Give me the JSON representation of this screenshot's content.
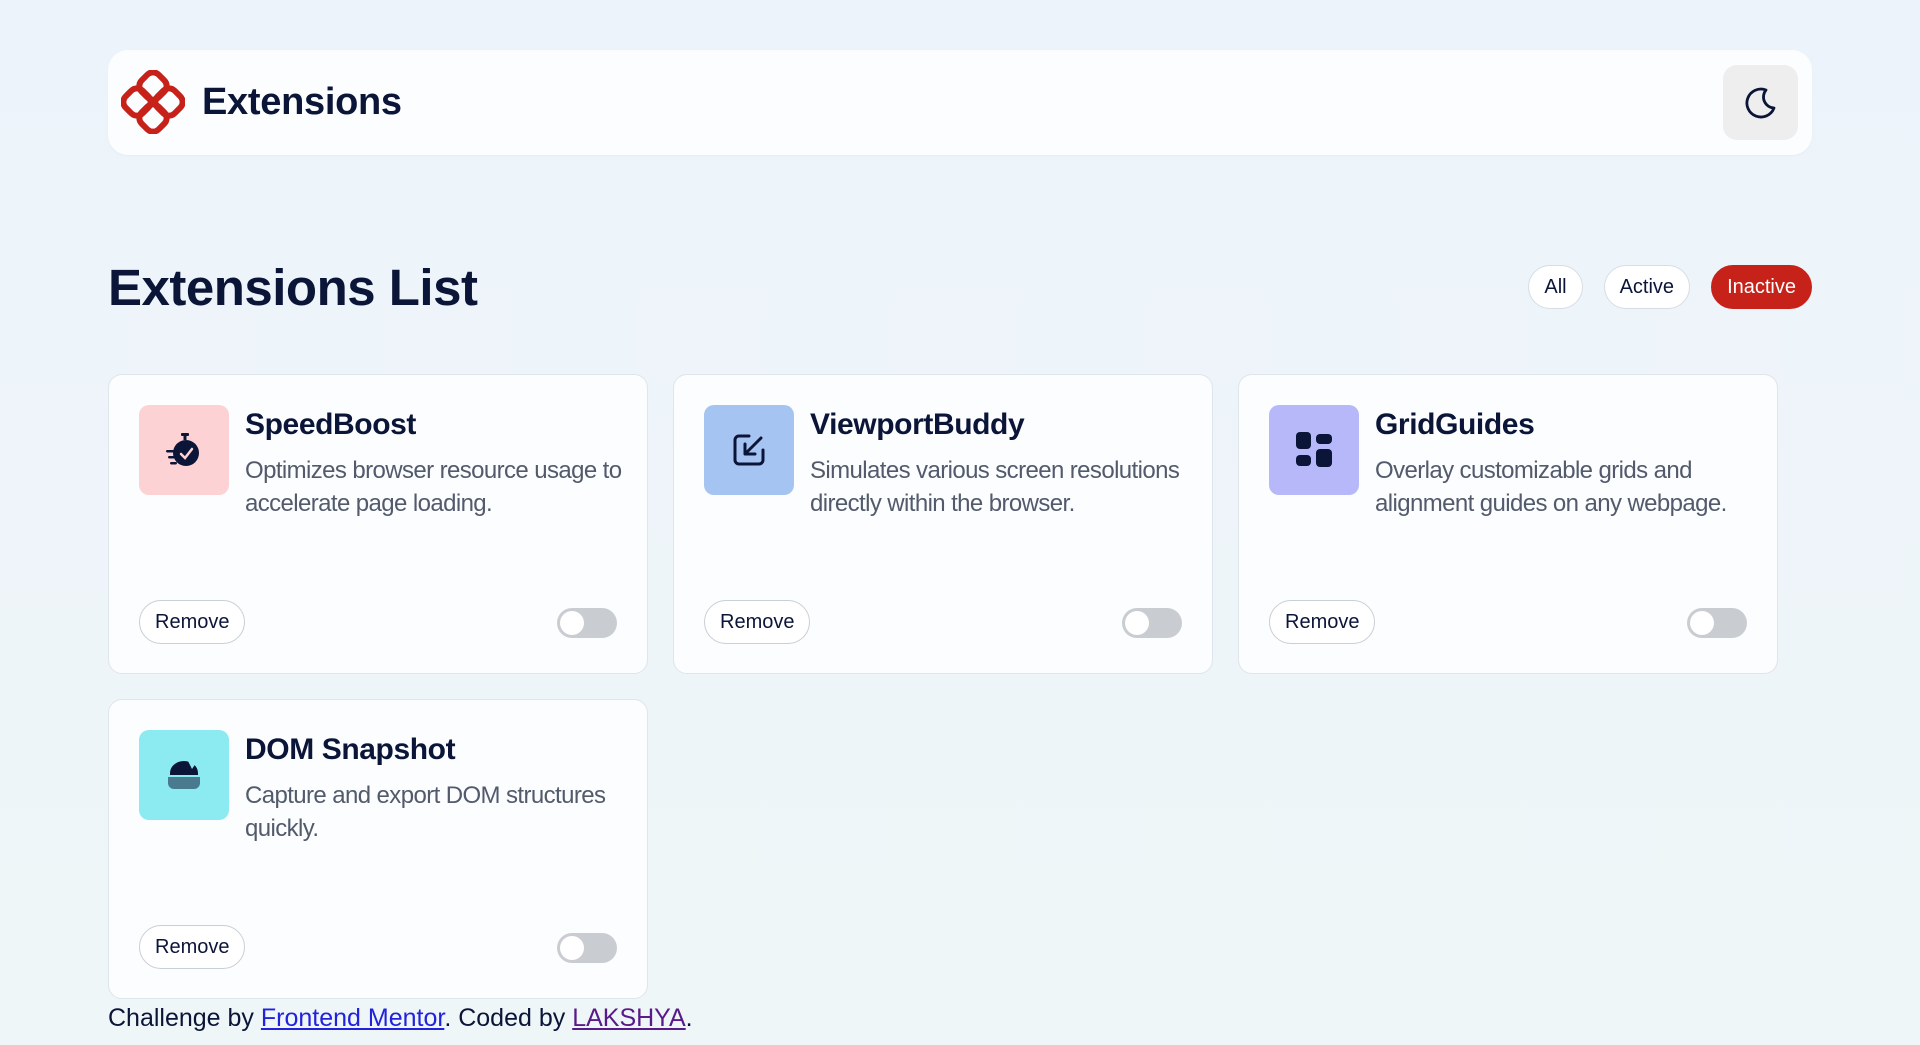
{
  "header": {
    "brand": "Extensions",
    "logo_icon": "extensions-logo-icon",
    "theme_icon": "moon-icon",
    "accent": "#c7221a"
  },
  "main": {
    "title": "Extensions List",
    "filters": [
      {
        "label": "All",
        "active": false
      },
      {
        "label": "Active",
        "active": false
      },
      {
        "label": "Inactive",
        "active": true
      }
    ]
  },
  "extensions": [
    {
      "name": "SpeedBoost",
      "description": "Optimizes browser resource usage to accelerate page loading.",
      "remove_label": "Remove",
      "enabled": false,
      "icon": "stopwatch-icon",
      "icon_bg": "#fdd2d5"
    },
    {
      "name": "ViewportBuddy",
      "description": "Simulates various screen resolutions directly within the browser.",
      "remove_label": "Remove",
      "enabled": false,
      "icon": "resize-arrow-icon",
      "icon_bg": "#a6c4f1"
    },
    {
      "name": "GridGuides",
      "description": "Overlay customizable grids and alignment guides on any webpage.",
      "remove_label": "Remove",
      "enabled": false,
      "icon": "grid-icon",
      "icon_bg": "#b6b8f9"
    },
    {
      "name": "DOM Snapshot",
      "description": "Capture and export DOM structures quickly.",
      "remove_label": "Remove",
      "enabled": false,
      "icon": "snapshot-icon",
      "icon_bg": "#8ceaf1"
    }
  ],
  "footer": {
    "prefix": "Challenge by ",
    "link1": "Frontend Mentor",
    "middle": ". Coded by ",
    "link2": "LAKSHYA",
    "suffix": "."
  }
}
